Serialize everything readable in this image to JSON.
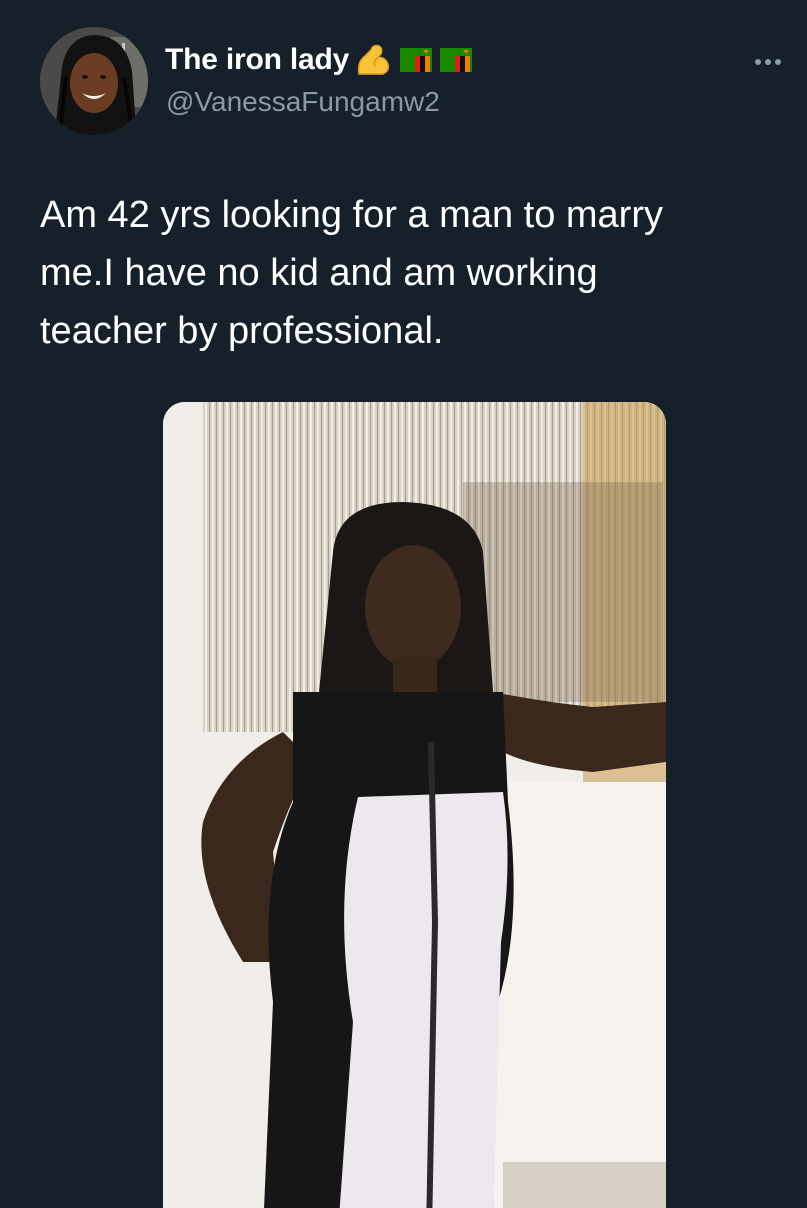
{
  "tweet": {
    "author": {
      "display_name": "The iron lady",
      "handle": "@VanessaFungamw2",
      "name_emojis": [
        "flexed-biceps-icon",
        "zambia-flag-icon",
        "zambia-flag-icon"
      ]
    },
    "text": "Am 42 yrs looking for a man to marry\nme.I have no kid and am working\nteacher by professional.",
    "more_icon": "more-options-icon",
    "media": {
      "type": "photo"
    }
  },
  "colors": {
    "background": "#15202b",
    "text_primary": "#ffffff",
    "text_secondary": "#8b98a5",
    "flag_green": "#198a00",
    "flag_red": "#de2010",
    "flag_orange": "#ef7d00",
    "emoji_yellow": "#f7c33b"
  }
}
